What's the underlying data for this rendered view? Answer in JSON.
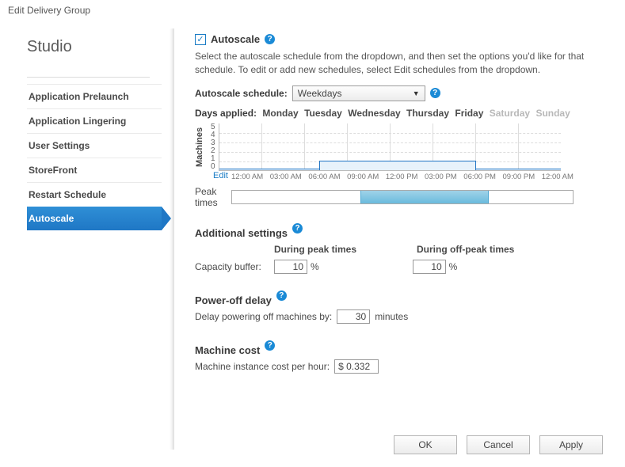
{
  "window": {
    "title": "Edit Delivery Group"
  },
  "brand": "Studio",
  "nav": {
    "items": [
      {
        "label": "Application Prelaunch"
      },
      {
        "label": "Application Lingering"
      },
      {
        "label": "User Settings"
      },
      {
        "label": "StoreFront"
      },
      {
        "label": "Restart Schedule"
      },
      {
        "label": "Autoscale",
        "active": true
      }
    ]
  },
  "autoscale": {
    "checkbox_checked": "✓",
    "title": "Autoscale",
    "description": "Select the autoscale schedule from the dropdown, and then set the options you'd like for that schedule. To edit or add new schedules, select Edit schedules from the dropdown.",
    "schedule_label": "Autoscale schedule:",
    "schedule_value": "Weekdays",
    "days_label": "Days applied:",
    "days": [
      "Monday",
      "Tuesday",
      "Wednesday",
      "Thursday",
      "Friday",
      "Saturday",
      "Sunday"
    ],
    "days_off": [
      "Saturday",
      "Sunday"
    ],
    "chart_ylabel": "Machines",
    "chart_edit": "Edit",
    "peak_label": "Peak times",
    "additional": {
      "title": "Additional settings",
      "col_peak": "During peak times",
      "col_off": "During off-peak times",
      "capacity_label": "Capacity buffer:",
      "capacity_peak": "10",
      "capacity_off": "10"
    },
    "poweroff": {
      "title": "Power-off delay",
      "label": "Delay powering off machines by:",
      "value": "30",
      "unit": "minutes"
    },
    "cost": {
      "title": "Machine cost",
      "label": "Machine instance cost per hour:",
      "value": "$ 0.332"
    }
  },
  "chart_data": {
    "type": "area",
    "title": "",
    "ylabel": "Machines",
    "ylim": [
      0,
      5
    ],
    "yticks": [
      0,
      1,
      2,
      3,
      4,
      5
    ],
    "x_ticks": [
      "12:00 AM",
      "03:00 AM",
      "06:00 AM",
      "09:00 AM",
      "12:00 PM",
      "03:00 PM",
      "06:00 PM",
      "09:00 PM",
      "12:00 AM"
    ],
    "x_hours": [
      0,
      3,
      6,
      9,
      12,
      15,
      18,
      21,
      24
    ],
    "series": [
      {
        "name": "Machines",
        "points": [
          {
            "h": 0,
            "v": 0
          },
          {
            "h": 7,
            "v": 0
          },
          {
            "h": 7,
            "v": 1
          },
          {
            "h": 18,
            "v": 1
          },
          {
            "h": 18,
            "v": 0
          },
          {
            "h": 24,
            "v": 0
          }
        ]
      }
    ],
    "peak_window": {
      "start_h": 9,
      "end_h": 18
    }
  },
  "buttons": {
    "ok": "OK",
    "cancel": "Cancel",
    "apply": "Apply"
  }
}
